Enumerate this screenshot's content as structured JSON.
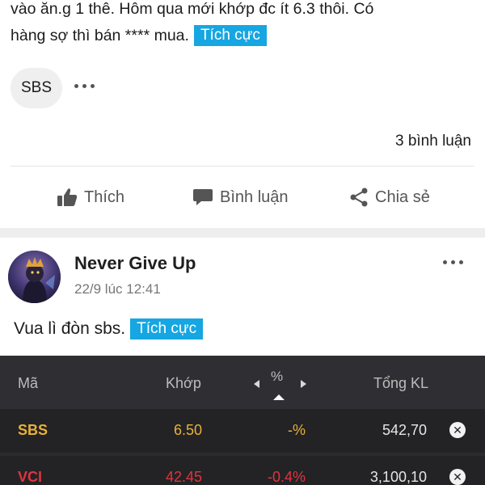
{
  "post1": {
    "line1": "vào ăn.g 1 thê. Hôm qua mới khớp đc ít 6.3 thôi. Có",
    "line2": "hàng sợ thì bán **** mua.",
    "tag": "Tích cực",
    "ticker_chip": "SBS",
    "comment_count": "3 bình luận",
    "actions": {
      "like": "Thích",
      "comment": "Bình luận",
      "share": "Chia sẻ"
    }
  },
  "post2": {
    "author": "Never Give Up",
    "time": "22/9 lúc 12:41",
    "text": "Vua lì đòn sbs.",
    "tag": "Tích cực"
  },
  "watchlist": {
    "headers": {
      "symbol": "Mã",
      "price": "Khớp",
      "percent": "%",
      "volume": "Tổng KL"
    },
    "rows": [
      {
        "symbol": "SBS",
        "price": "6.50",
        "percent": "-%",
        "volume": "542,70",
        "color": "#e8b13a"
      },
      {
        "symbol": "VCI",
        "price": "42.45",
        "percent": "-0.4%",
        "volume": "3,100,10",
        "color": "#e0343c"
      }
    ]
  },
  "colors": {
    "accent_tag": "#16a6e2",
    "table_bg": "#2b2b2e",
    "reference": "#e8b13a",
    "down": "#e0343c"
  },
  "icons": {
    "like": "thumbs-up-icon",
    "comment": "comment-bubble-icon",
    "share": "share-icon",
    "more": "more-horizontal-icon",
    "remove": "close-circle-icon"
  }
}
